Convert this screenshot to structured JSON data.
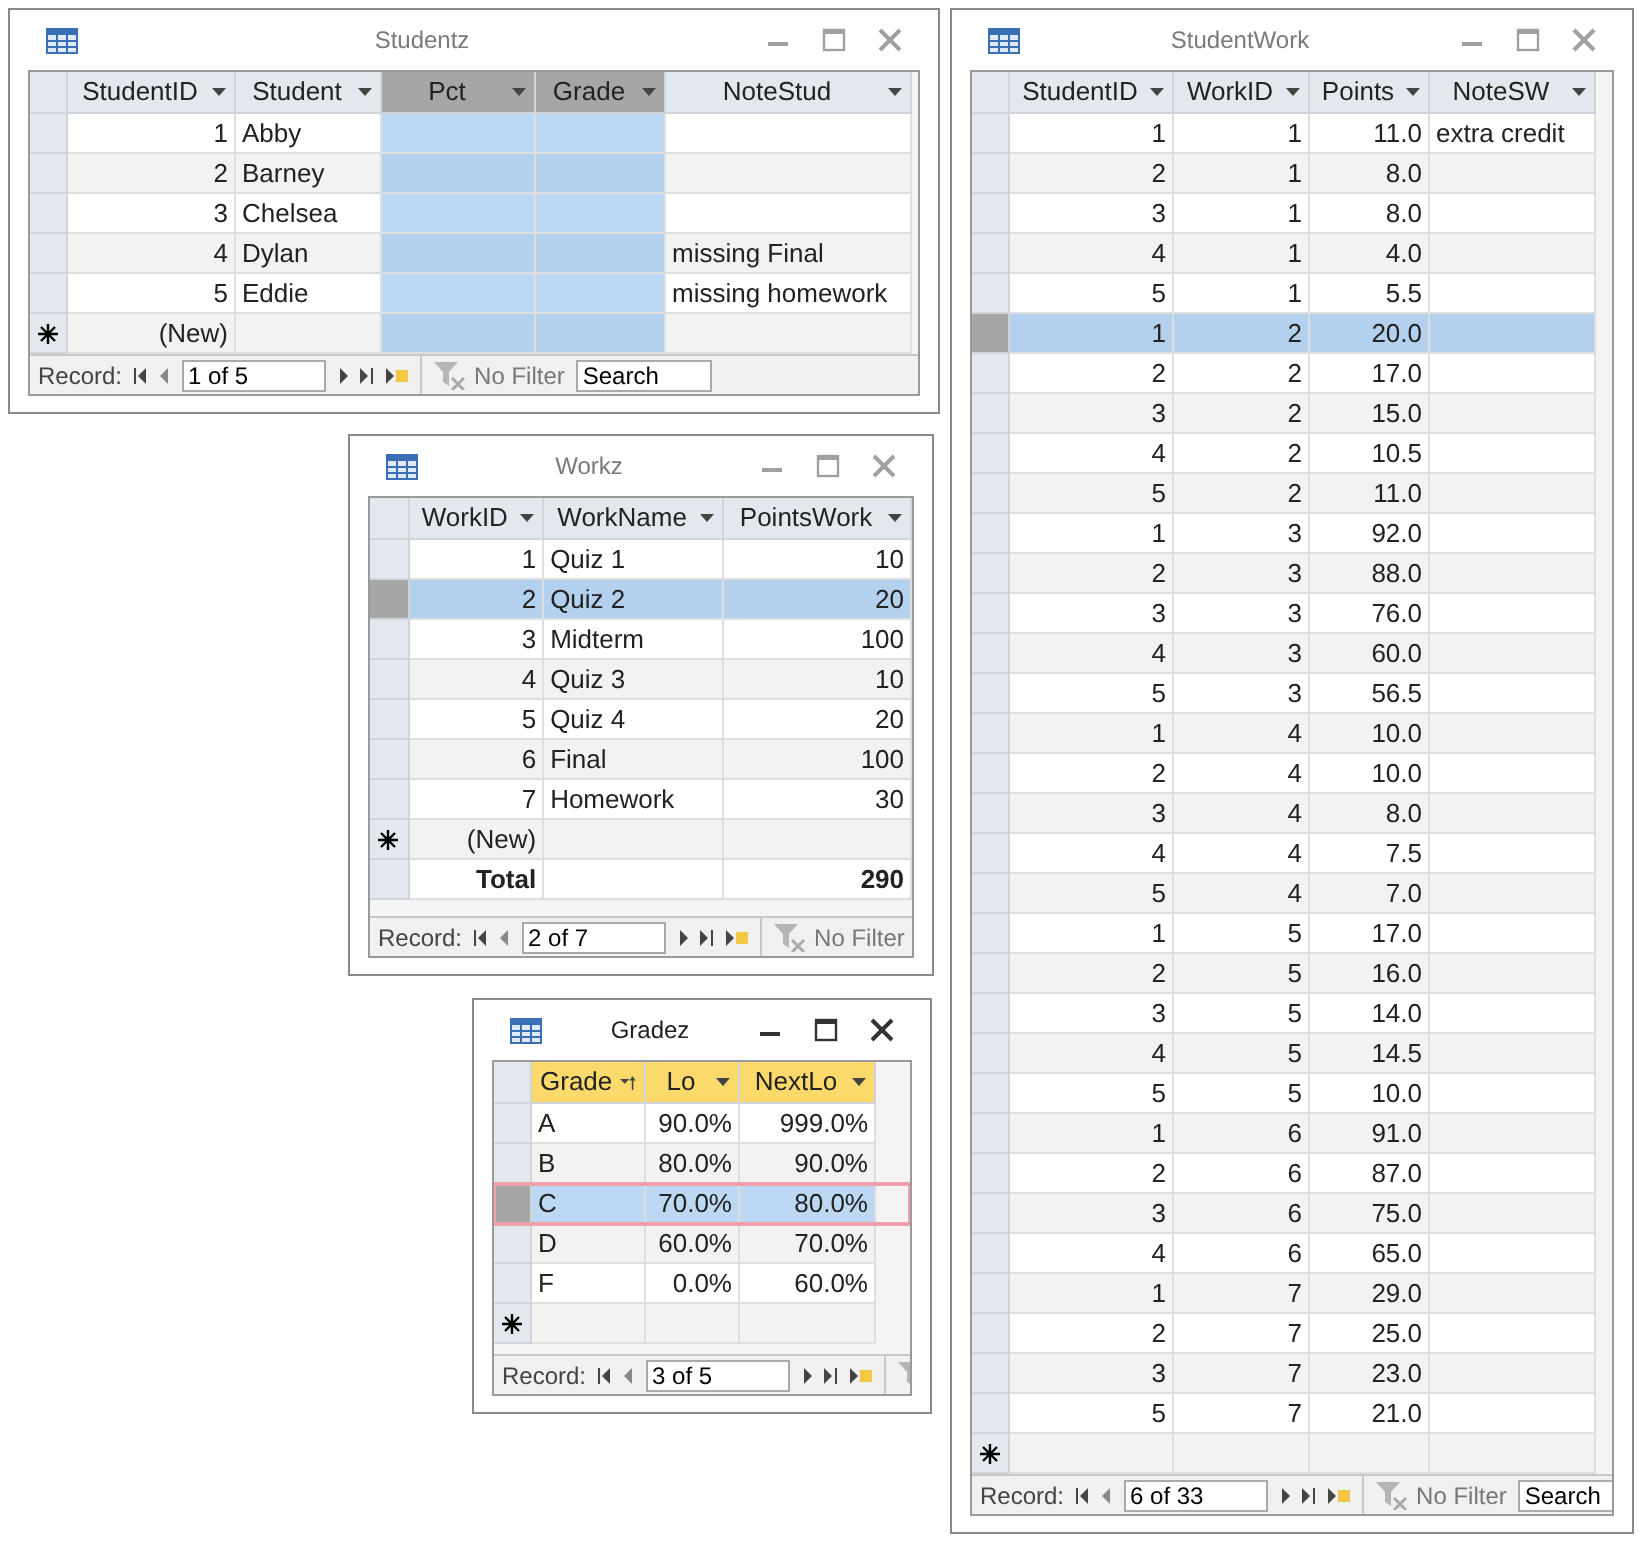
{
  "windows": [
    {
      "title": "Studentz",
      "active": false,
      "columns": [
        {
          "label": "StudentID",
          "selected": false
        },
        {
          "label": "Student",
          "selected": false
        },
        {
          "label": "Pct",
          "selected": true
        },
        {
          "label": "Grade",
          "selected": true
        },
        {
          "label": "NoteStud",
          "selected": false
        }
      ],
      "rows": [
        {
          "kind": "record",
          "selected": false,
          "cells": [
            "1",
            "Abby",
            "",
            "",
            ""
          ]
        },
        {
          "kind": "record",
          "selected": false,
          "cells": [
            "2",
            "Barney",
            "",
            "",
            ""
          ]
        },
        {
          "kind": "record",
          "selected": false,
          "cells": [
            "3",
            "Chelsea",
            "",
            "",
            ""
          ]
        },
        {
          "kind": "record",
          "selected": false,
          "cells": [
            "4",
            "Dylan",
            "",
            "",
            "missing Final"
          ]
        },
        {
          "kind": "record",
          "selected": false,
          "cells": [
            "5",
            "Eddie",
            "",
            "",
            "missing homework"
          ]
        },
        {
          "kind": "new",
          "selected": false,
          "cells": [
            "(New)",
            "",
            "",
            "",
            ""
          ]
        }
      ],
      "nav": {
        "label": "Record:",
        "position": "1 of 5",
        "filter": "No Filter",
        "search_value": "Search"
      }
    },
    {
      "title": "Workz",
      "active": false,
      "columns": [
        {
          "label": "WorkID",
          "selected": false
        },
        {
          "label": "WorkName",
          "selected": false
        },
        {
          "label": "PointsWork",
          "selected": false
        }
      ],
      "rows": [
        {
          "kind": "record",
          "selected": false,
          "cells": [
            "1",
            "Quiz 1",
            "10"
          ]
        },
        {
          "kind": "record",
          "selected": true,
          "cells": [
            "2",
            "Quiz 2",
            "20"
          ]
        },
        {
          "kind": "record",
          "selected": false,
          "cells": [
            "3",
            "Midterm",
            "100"
          ]
        },
        {
          "kind": "record",
          "selected": false,
          "cells": [
            "4",
            "Quiz 3",
            "10"
          ]
        },
        {
          "kind": "record",
          "selected": false,
          "cells": [
            "5",
            "Quiz 4",
            "20"
          ]
        },
        {
          "kind": "record",
          "selected": false,
          "cells": [
            "6",
            "Final",
            "100"
          ]
        },
        {
          "kind": "record",
          "selected": false,
          "cells": [
            "7",
            "Homework",
            "30"
          ]
        },
        {
          "kind": "new",
          "selected": false,
          "cells": [
            "(New)",
            "",
            ""
          ]
        },
        {
          "kind": "total",
          "selected": false,
          "cells": [
            "Total",
            "",
            "290"
          ]
        }
      ],
      "nav": {
        "label": "Record:",
        "position": "2 of 7",
        "filter": "No Filter"
      }
    },
    {
      "title": "Gradez",
      "active": true,
      "columns": [
        {
          "label": "Grade",
          "selected": false,
          "highlighted": true,
          "sorted": true
        },
        {
          "label": "Lo",
          "selected": false,
          "highlighted": true,
          "sorted": false
        },
        {
          "label": "NextLo",
          "selected": false,
          "highlighted": true,
          "sorted": false
        }
      ],
      "rows": [
        {
          "kind": "record",
          "selected": false,
          "cells": [
            "A",
            "90.0%",
            "999.0%"
          ]
        },
        {
          "kind": "record",
          "selected": false,
          "cells": [
            "B",
            "80.0%",
            "90.0%"
          ]
        },
        {
          "kind": "record",
          "selected": true,
          "cells": [
            "C",
            "70.0%",
            "80.0%"
          ]
        },
        {
          "kind": "record",
          "selected": false,
          "cells": [
            "D",
            "60.0%",
            "70.0%"
          ]
        },
        {
          "kind": "record",
          "selected": false,
          "cells": [
            "F",
            "0.0%",
            "60.0%"
          ]
        },
        {
          "kind": "new",
          "selected": false,
          "cells": [
            "",
            "",
            ""
          ]
        }
      ],
      "nav": {
        "label": "Record:",
        "position": "3 of 5"
      }
    },
    {
      "title": "StudentWork",
      "active": false,
      "columns": [
        {
          "label": "StudentID",
          "selected": false
        },
        {
          "label": "WorkID",
          "selected": false
        },
        {
          "label": "Points",
          "selected": false
        },
        {
          "label": "NoteSW",
          "selected": false
        }
      ],
      "rows": [
        {
          "kind": "record",
          "selected": false,
          "cells": [
            "1",
            "1",
            "11.0",
            "extra credit"
          ]
        },
        {
          "kind": "record",
          "selected": false,
          "cells": [
            "2",
            "1",
            "8.0",
            ""
          ]
        },
        {
          "kind": "record",
          "selected": false,
          "cells": [
            "3",
            "1",
            "8.0",
            ""
          ]
        },
        {
          "kind": "record",
          "selected": false,
          "cells": [
            "4",
            "1",
            "4.0",
            ""
          ]
        },
        {
          "kind": "record",
          "selected": false,
          "cells": [
            "5",
            "1",
            "5.5",
            ""
          ]
        },
        {
          "kind": "record",
          "selected": true,
          "cells": [
            "1",
            "2",
            "20.0",
            ""
          ]
        },
        {
          "kind": "record",
          "selected": false,
          "cells": [
            "2",
            "2",
            "17.0",
            ""
          ]
        },
        {
          "kind": "record",
          "selected": false,
          "cells": [
            "3",
            "2",
            "15.0",
            ""
          ]
        },
        {
          "kind": "record",
          "selected": false,
          "cells": [
            "4",
            "2",
            "10.5",
            ""
          ]
        },
        {
          "kind": "record",
          "selected": false,
          "cells": [
            "5",
            "2",
            "11.0",
            ""
          ]
        },
        {
          "kind": "record",
          "selected": false,
          "cells": [
            "1",
            "3",
            "92.0",
            ""
          ]
        },
        {
          "kind": "record",
          "selected": false,
          "cells": [
            "2",
            "3",
            "88.0",
            ""
          ]
        },
        {
          "kind": "record",
          "selected": false,
          "cells": [
            "3",
            "3",
            "76.0",
            ""
          ]
        },
        {
          "kind": "record",
          "selected": false,
          "cells": [
            "4",
            "3",
            "60.0",
            ""
          ]
        },
        {
          "kind": "record",
          "selected": false,
          "cells": [
            "5",
            "3",
            "56.5",
            ""
          ]
        },
        {
          "kind": "record",
          "selected": false,
          "cells": [
            "1",
            "4",
            "10.0",
            ""
          ]
        },
        {
          "kind": "record",
          "selected": false,
          "cells": [
            "2",
            "4",
            "10.0",
            ""
          ]
        },
        {
          "kind": "record",
          "selected": false,
          "cells": [
            "3",
            "4",
            "8.0",
            ""
          ]
        },
        {
          "kind": "record",
          "selected": false,
          "cells": [
            "4",
            "4",
            "7.5",
            ""
          ]
        },
        {
          "kind": "record",
          "selected": false,
          "cells": [
            "5",
            "4",
            "7.0",
            ""
          ]
        },
        {
          "kind": "record",
          "selected": false,
          "cells": [
            "1",
            "5",
            "17.0",
            ""
          ]
        },
        {
          "kind": "record",
          "selected": false,
          "cells": [
            "2",
            "5",
            "16.0",
            ""
          ]
        },
        {
          "kind": "record",
          "selected": false,
          "cells": [
            "3",
            "5",
            "14.0",
            ""
          ]
        },
        {
          "kind": "record",
          "selected": false,
          "cells": [
            "4",
            "5",
            "14.5",
            ""
          ]
        },
        {
          "kind": "record",
          "selected": false,
          "cells": [
            "5",
            "5",
            "10.0",
            ""
          ]
        },
        {
          "kind": "record",
          "selected": false,
          "cells": [
            "1",
            "6",
            "91.0",
            ""
          ]
        },
        {
          "kind": "record",
          "selected": false,
          "cells": [
            "2",
            "6",
            "87.0",
            ""
          ]
        },
        {
          "kind": "record",
          "selected": false,
          "cells": [
            "3",
            "6",
            "75.0",
            ""
          ]
        },
        {
          "kind": "record",
          "selected": false,
          "cells": [
            "4",
            "6",
            "65.0",
            ""
          ]
        },
        {
          "kind": "record",
          "selected": false,
          "cells": [
            "1",
            "7",
            "29.0",
            ""
          ]
        },
        {
          "kind": "record",
          "selected": false,
          "cells": [
            "2",
            "7",
            "25.0",
            ""
          ]
        },
        {
          "kind": "record",
          "selected": false,
          "cells": [
            "3",
            "7",
            "23.0",
            ""
          ]
        },
        {
          "kind": "record",
          "selected": false,
          "cells": [
            "5",
            "7",
            "21.0",
            ""
          ]
        },
        {
          "kind": "new",
          "selected": false,
          "cells": [
            "",
            "",
            "",
            ""
          ]
        }
      ],
      "nav": {
        "label": "Record:",
        "position": "6 of 33",
        "filter": "No Filter",
        "search_value": "Search"
      }
    }
  ]
}
